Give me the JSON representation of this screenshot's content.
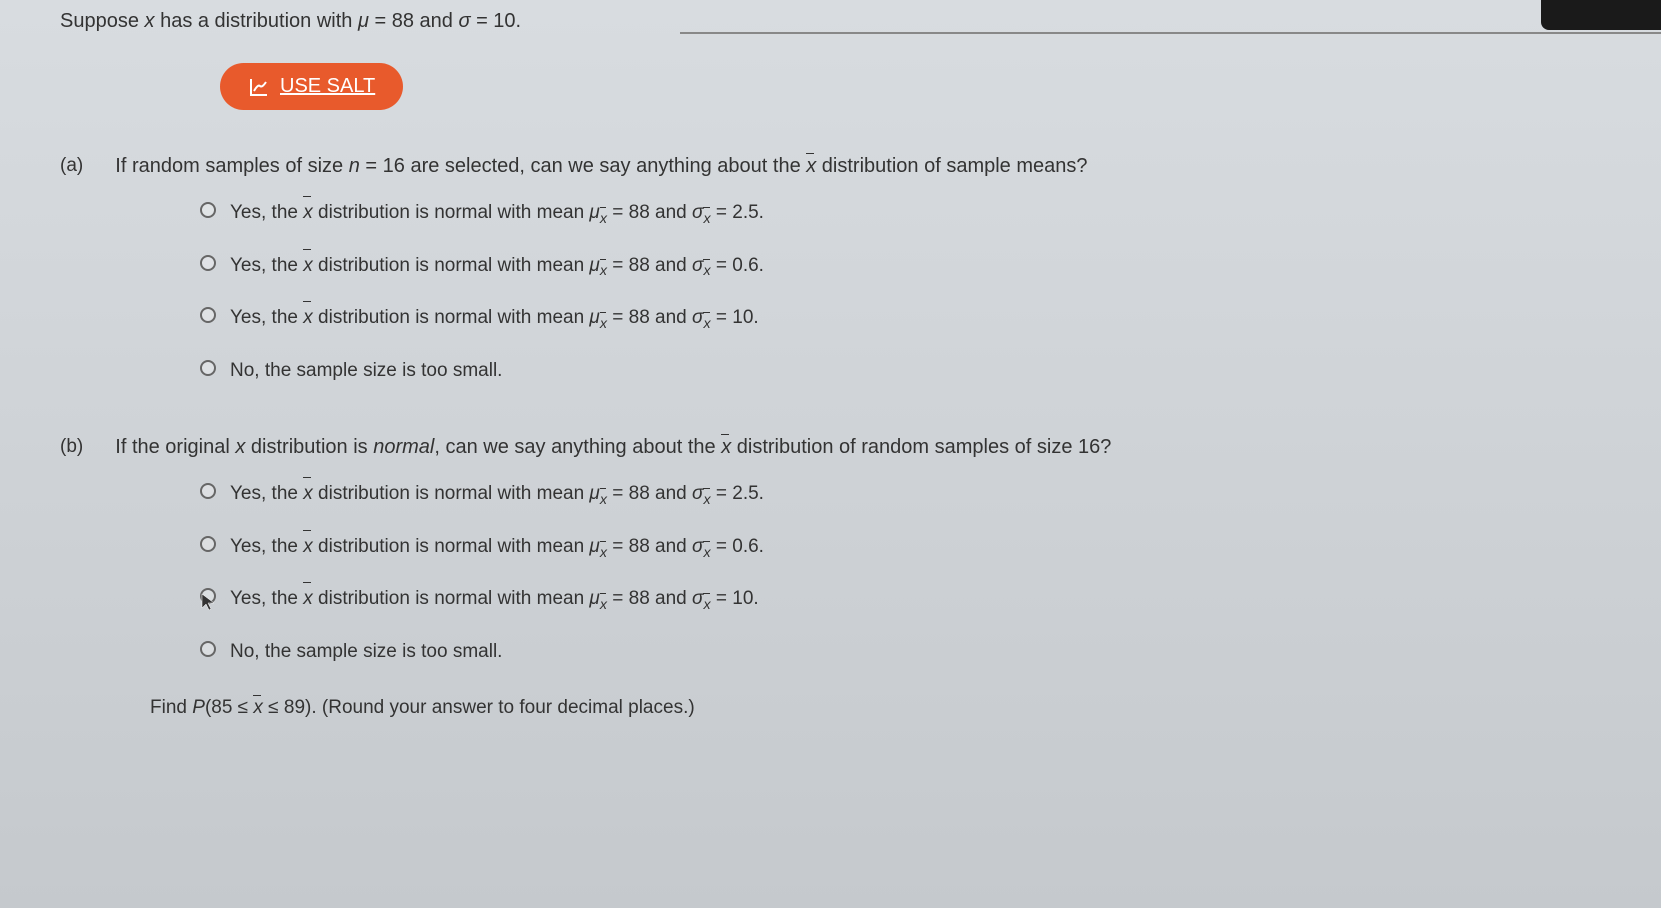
{
  "intro": {
    "prefix": "Suppose ",
    "var": "x",
    "mid1": " has a distribution with ",
    "mu": "μ",
    "eq1": " = 88 and ",
    "sigma": "σ",
    "eq2": " = 10."
  },
  "salt": {
    "label": "USE SALT"
  },
  "partA": {
    "label": "(a)",
    "q_prefix": "If random samples of size ",
    "q_n": "n",
    "q_mid": " = 16 are selected, can we say anything about the ",
    "q_xbar": "x",
    "q_suffix": " distribution of sample means?",
    "options": [
      {
        "prefix": "Yes, the ",
        "xbar": "x",
        "mid": " distribution is normal with mean ",
        "mu": "μ",
        "subx": "x",
        "eq1": " = 88 and ",
        "sig": "σ",
        "subx2": "x",
        "eq2": " = 2.5."
      },
      {
        "prefix": "Yes, the ",
        "xbar": "x",
        "mid": " distribution is normal with mean ",
        "mu": "μ",
        "subx": "x",
        "eq1": " = 88 and ",
        "sig": "σ",
        "subx2": "x",
        "eq2": " = 0.6."
      },
      {
        "prefix": "Yes, the ",
        "xbar": "x",
        "mid": " distribution is normal with mean ",
        "mu": "μ",
        "subx": "x",
        "eq1": " = 88 and ",
        "sig": "σ",
        "subx2": "x",
        "eq2": " = 10."
      },
      {
        "text": "No, the sample size is too small."
      }
    ]
  },
  "partB": {
    "label": "(b)",
    "q_prefix": "If the original ",
    "q_x": "x",
    "q_mid1": " distribution is ",
    "q_normal": "normal",
    "q_mid2": ", can we say anything about the ",
    "q_xbar": "x",
    "q_suffix": " distribution of random samples of size 16?",
    "options": [
      {
        "prefix": "Yes, the ",
        "xbar": "x",
        "mid": " distribution is normal with mean ",
        "mu": "μ",
        "subx": "x",
        "eq1": " = 88 and ",
        "sig": "σ",
        "subx2": "x",
        "eq2": " = 2.5."
      },
      {
        "prefix": "Yes, the ",
        "xbar": "x",
        "mid": " distribution is normal with mean ",
        "mu": "μ",
        "subx": "x",
        "eq1": " = 88 and ",
        "sig": "σ",
        "subx2": "x",
        "eq2": " = 0.6."
      },
      {
        "prefix": "Yes, the ",
        "xbar": "x",
        "mid": " distribution is normal with mean ",
        "mu": "μ",
        "subx": "x",
        "eq1": " = 88 and ",
        "sig": "σ",
        "subx2": "x",
        "eq2": " = 10."
      },
      {
        "text": "No, the sample size is too small."
      }
    ]
  },
  "find": {
    "prefix": "Find ",
    "P": "P",
    "open": "(85 ≤ ",
    "xbar": "x",
    "close": " ≤ 89). (Round your answer to four decimal places.)"
  }
}
